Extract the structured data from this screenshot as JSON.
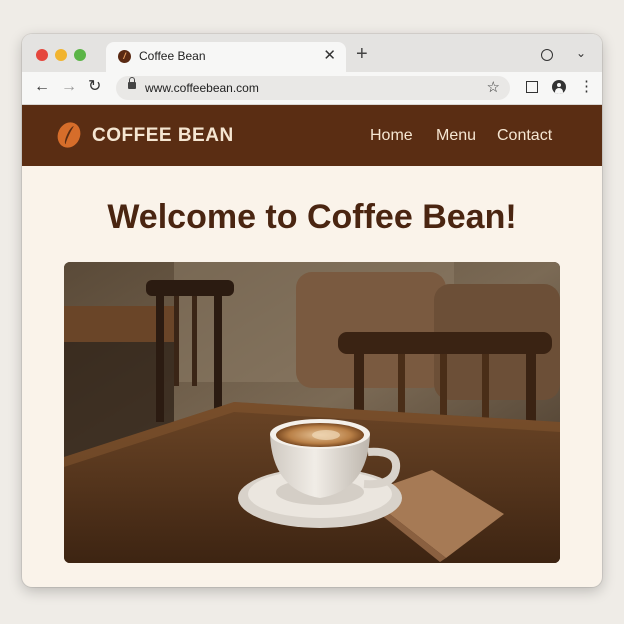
{
  "browser": {
    "tab_title": "Coffee Bean",
    "favicon_glyph": "/",
    "tab_close": "✕",
    "new_tab": "+",
    "url": "www.coffeebean.com",
    "icons": {
      "back": "arrow-left-icon",
      "forward": "arrow-right-icon",
      "reload": "reload-icon",
      "lock": "lock-icon",
      "bookmark": "star-icon",
      "tab_search": "circle-icon",
      "tabs_dropdown": "chevron-down-icon",
      "extensions": "square-icon",
      "profile": "profile-icon",
      "menu": "kebab-menu-icon"
    },
    "glyphs": {
      "back": "←",
      "forward": "→",
      "reload": "↻",
      "bookmark": "☆",
      "tabs_dropdown": "⌄",
      "menu": "⋮"
    }
  },
  "site": {
    "brand": "COFFEE BEAN",
    "nav": [
      "Home",
      "Menu",
      "Contact"
    ],
    "hero_title": "Welcome to Coffee Bean!",
    "hero_image": "coffee-cup-on-cafe-table-photo"
  },
  "colors": {
    "header_bg": "#5a2d13",
    "page_bg": "#faf3ea",
    "title_text": "#4a2511",
    "logo_accent": "#d66d2a"
  }
}
